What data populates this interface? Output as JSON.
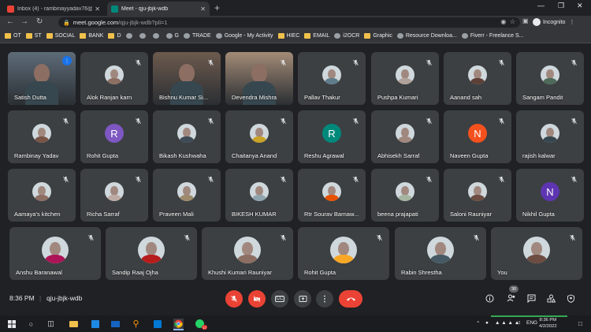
{
  "browser": {
    "tabs": [
      {
        "title": "Inbox (4) - rambinayyadav76@g",
        "favicon_color": "#ea4335",
        "active": false
      },
      {
        "title": "Meet - qju-jbjk-wdb",
        "favicon_color": "#00897b",
        "active": true
      }
    ],
    "url_host": "meet.google.com",
    "url_path": "/qju-jbjk-wdb?pli=1",
    "profile_label": "Incognito",
    "bookmarks": [
      {
        "label": "OT",
        "icon": "folder-icon"
      },
      {
        "label": "ST",
        "icon": "folder-icon"
      },
      {
        "label": "SOCIAL",
        "icon": "folder-icon"
      },
      {
        "label": "BANK",
        "icon": "folder-icon"
      },
      {
        "label": "D",
        "icon": "folder-icon"
      },
      {
        "label": "",
        "icon": "site-icon"
      },
      {
        "label": "",
        "icon": "site-icon"
      },
      {
        "label": "",
        "icon": "site-icon"
      },
      {
        "label": "G",
        "icon": "site-icon"
      },
      {
        "label": "TRADE",
        "icon": "site-icon"
      },
      {
        "label": "Google - My Activity",
        "icon": "site-icon"
      },
      {
        "label": "HIEC",
        "icon": "folder-icon"
      },
      {
        "label": "EMAIL",
        "icon": "folder-icon"
      },
      {
        "label": "i2OCR",
        "icon": "site-icon"
      },
      {
        "label": "Graphic",
        "icon": "folder-icon"
      },
      {
        "label": "Resource Downloa...",
        "icon": "site-icon"
      },
      {
        "label": "Fiverr - Freelance S...",
        "icon": "site-icon"
      }
    ]
  },
  "meeting": {
    "time": "8:36 PM",
    "separator": "|",
    "code": "qju-jbjk-wdb",
    "participant_count": "30",
    "participants": [
      {
        "name": "Satish Dutta",
        "kind": "video",
        "color": "#5d6b78",
        "speaking": true
      },
      {
        "name": "Alok Ranjan karn",
        "kind": "photo",
        "color": "#8d6e63"
      },
      {
        "name": "Bishnu Kumar Si...",
        "kind": "video",
        "color": "#6d5a4e"
      },
      {
        "name": "Devendra Mishra",
        "kind": "video",
        "color": "#a38b77"
      },
      {
        "name": "Pallav Thakur",
        "kind": "photo",
        "color": "#607d8b"
      },
      {
        "name": "Pushpa Kumari",
        "kind": "photo",
        "color": "#b0a29a"
      },
      {
        "name": "Aanand sah",
        "kind": "photo",
        "color": "#5d4037"
      },
      {
        "name": "Sangam Pandit",
        "kind": "photo",
        "color": "#4e6a5a"
      },
      {
        "name": "Rambinay Yadav",
        "kind": "photo",
        "color": "#795548"
      },
      {
        "name": "Rohit Gupta",
        "kind": "letter",
        "letter": "R",
        "color": "#7e57c2"
      },
      {
        "name": "Bikash Kushwaha",
        "kind": "photo",
        "color": "#3e4a55"
      },
      {
        "name": "Chaitanya Anand",
        "kind": "photo",
        "color": "#c9a227"
      },
      {
        "name": "Reshu Agrawal",
        "kind": "letter",
        "letter": "R",
        "color": "#00897b"
      },
      {
        "name": "Abhisekh Sarraf",
        "kind": "photo",
        "color": "#a1887f"
      },
      {
        "name": "Naveen Gupta",
        "kind": "letter",
        "letter": "N",
        "color": "#f4511e"
      },
      {
        "name": "rajish kalwar",
        "kind": "photo",
        "color": "#37474f"
      },
      {
        "name": "Aamaya's kitchen",
        "kind": "photo",
        "color": "#8d6e63"
      },
      {
        "name": "Richa Sarraf",
        "kind": "photo",
        "color": "#bcaaa4"
      },
      {
        "name": "Praveen Mali",
        "kind": "photo",
        "color": "#9e8a6a"
      },
      {
        "name": "BIKESH KUMAR",
        "kind": "photo",
        "color": "#90a4ae"
      },
      {
        "name": "Rtr Sourav Barnaw...",
        "kind": "photo",
        "color": "#e65100"
      },
      {
        "name": "beena prajapati",
        "kind": "photo",
        "color": "#a5b5a0"
      },
      {
        "name": "Saloni Rauniyar",
        "kind": "photo",
        "color": "#6d4c41"
      },
      {
        "name": "Nikhil Gupta",
        "kind": "letter",
        "letter": "N",
        "color": "#5e35b1"
      },
      {
        "name": "Anshu Baranawal",
        "kind": "photo",
        "color": "#ad1457"
      },
      {
        "name": "Sandip Raaj Ojha",
        "kind": "photo",
        "color": "#b71c1c"
      },
      {
        "name": "Khushi Kumari Rauniyar",
        "kind": "photo",
        "color": "#8d6e63"
      },
      {
        "name": "Rohit Gupta",
        "kind": "photo",
        "color": "#f9a825"
      },
      {
        "name": "Rabin Shrestha",
        "kind": "photo",
        "color": "#455a64"
      },
      {
        "name": "You",
        "kind": "photo",
        "color": "#6d4c41"
      }
    ]
  },
  "controls": {
    "center": [
      "mic-off-icon",
      "camera-off-icon",
      "captions-icon",
      "present-icon",
      "more-options-icon",
      "leave-call-icon"
    ],
    "right": [
      "info-icon",
      "people-icon",
      "chat-icon",
      "activities-icon",
      "host-controls-icon"
    ],
    "captions_label": "CC",
    "accent_red": "#ea4335"
  },
  "taskbar": {
    "language": "ENG",
    "time": "8:36 PM",
    "date": "4/2/2022"
  }
}
